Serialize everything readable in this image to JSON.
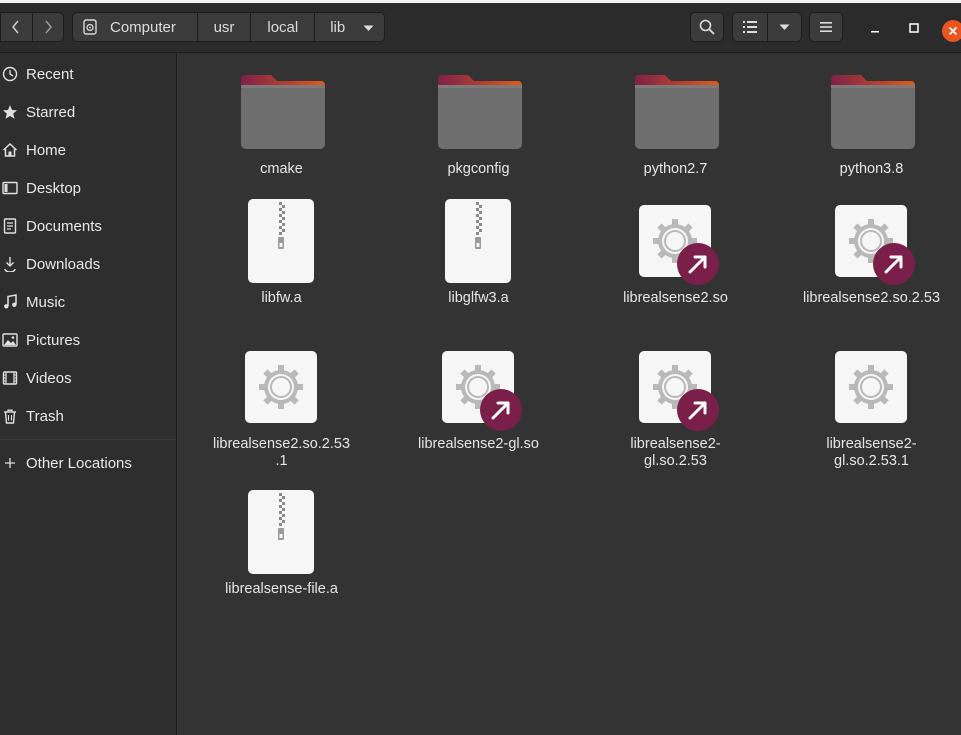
{
  "window": {
    "breadcrumb": [
      "Computer",
      "usr",
      "local",
      "lib"
    ],
    "accent_color": "#e9541f"
  },
  "sidebar": {
    "items": [
      {
        "label": "Recent",
        "icon": "clock-icon"
      },
      {
        "label": "Starred",
        "icon": "star-icon"
      },
      {
        "label": "Home",
        "icon": "home-icon"
      },
      {
        "label": "Desktop",
        "icon": "desktop-icon"
      },
      {
        "label": "Documents",
        "icon": "document-icon"
      },
      {
        "label": "Downloads",
        "icon": "download-icon"
      },
      {
        "label": "Music",
        "icon": "music-icon"
      },
      {
        "label": "Pictures",
        "icon": "pictures-icon"
      },
      {
        "label": "Videos",
        "icon": "video-icon"
      },
      {
        "label": "Trash",
        "icon": "trash-icon"
      },
      {
        "label": "Other Locations",
        "icon": "plus-icon"
      }
    ]
  },
  "files": [
    {
      "name": "cmake",
      "type": "folder"
    },
    {
      "name": "pkgconfig",
      "type": "folder"
    },
    {
      "name": "python2.7",
      "type": "folder"
    },
    {
      "name": "python3.8",
      "type": "folder"
    },
    {
      "name": "libfw.a",
      "type": "archive"
    },
    {
      "name": "libglfw3.a",
      "type": "archive"
    },
    {
      "name": "librealsense2.so",
      "type": "library-link"
    },
    {
      "name": "librealsense2.so.2.53",
      "type": "library-link"
    },
    {
      "name": "librealsense2.so.2.53.1",
      "type": "library"
    },
    {
      "name": "librealsense2-gl.so",
      "type": "library-link"
    },
    {
      "name": "librealsense2-gl.so.2.53",
      "type": "library-link"
    },
    {
      "name": "librealsense2-gl.so.2.53.1",
      "type": "library"
    },
    {
      "name": "librealsense-file.a",
      "type": "archive"
    }
  ],
  "colors": {
    "folder_top": "#c7441f",
    "folder_body": "#6b6b6b",
    "link_badge": "#7a1e4a"
  }
}
